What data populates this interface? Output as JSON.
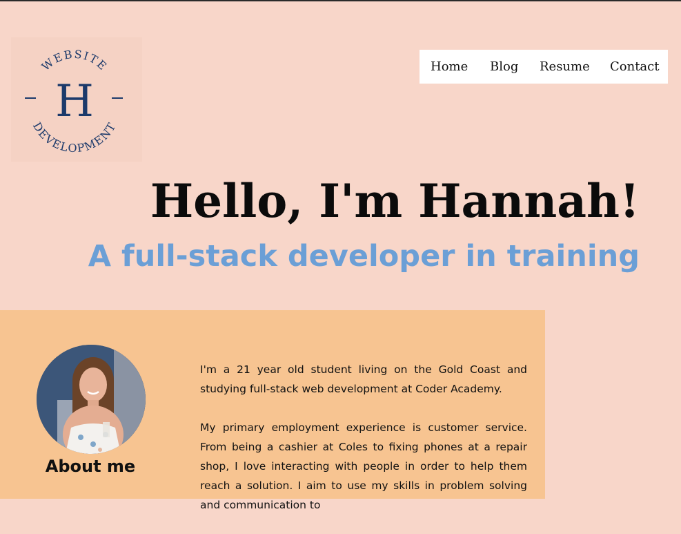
{
  "logo": {
    "top_text": "WEBSITE",
    "letter": "H",
    "bottom_text": "DEVELOPMENT",
    "color": "#1c3a6b"
  },
  "nav": {
    "items": [
      {
        "label": "Home"
      },
      {
        "label": "Blog"
      },
      {
        "label": "Resume"
      },
      {
        "label": "Contact"
      }
    ]
  },
  "hero": {
    "title": "Hello, I'm Hannah!",
    "subtitle": "A full-stack developer in training"
  },
  "about": {
    "heading": "About me",
    "paragraphs": [
      "I'm a 21 year old student living on the Gold Coast and studying full-stack web development at Coder Academy.",
      "My primary employment experience is customer service. From being a cashier at Coles to fixing phones at a repair shop, I love interacting with people in order to help them reach a solution. I aim to use my skills in problem solving and communication to"
    ]
  },
  "colors": {
    "page_bg": "#f8d6c9",
    "about_bg": "#f7c491",
    "subtitle": "#6b9fd6",
    "nav_bg": "#ffffff"
  }
}
